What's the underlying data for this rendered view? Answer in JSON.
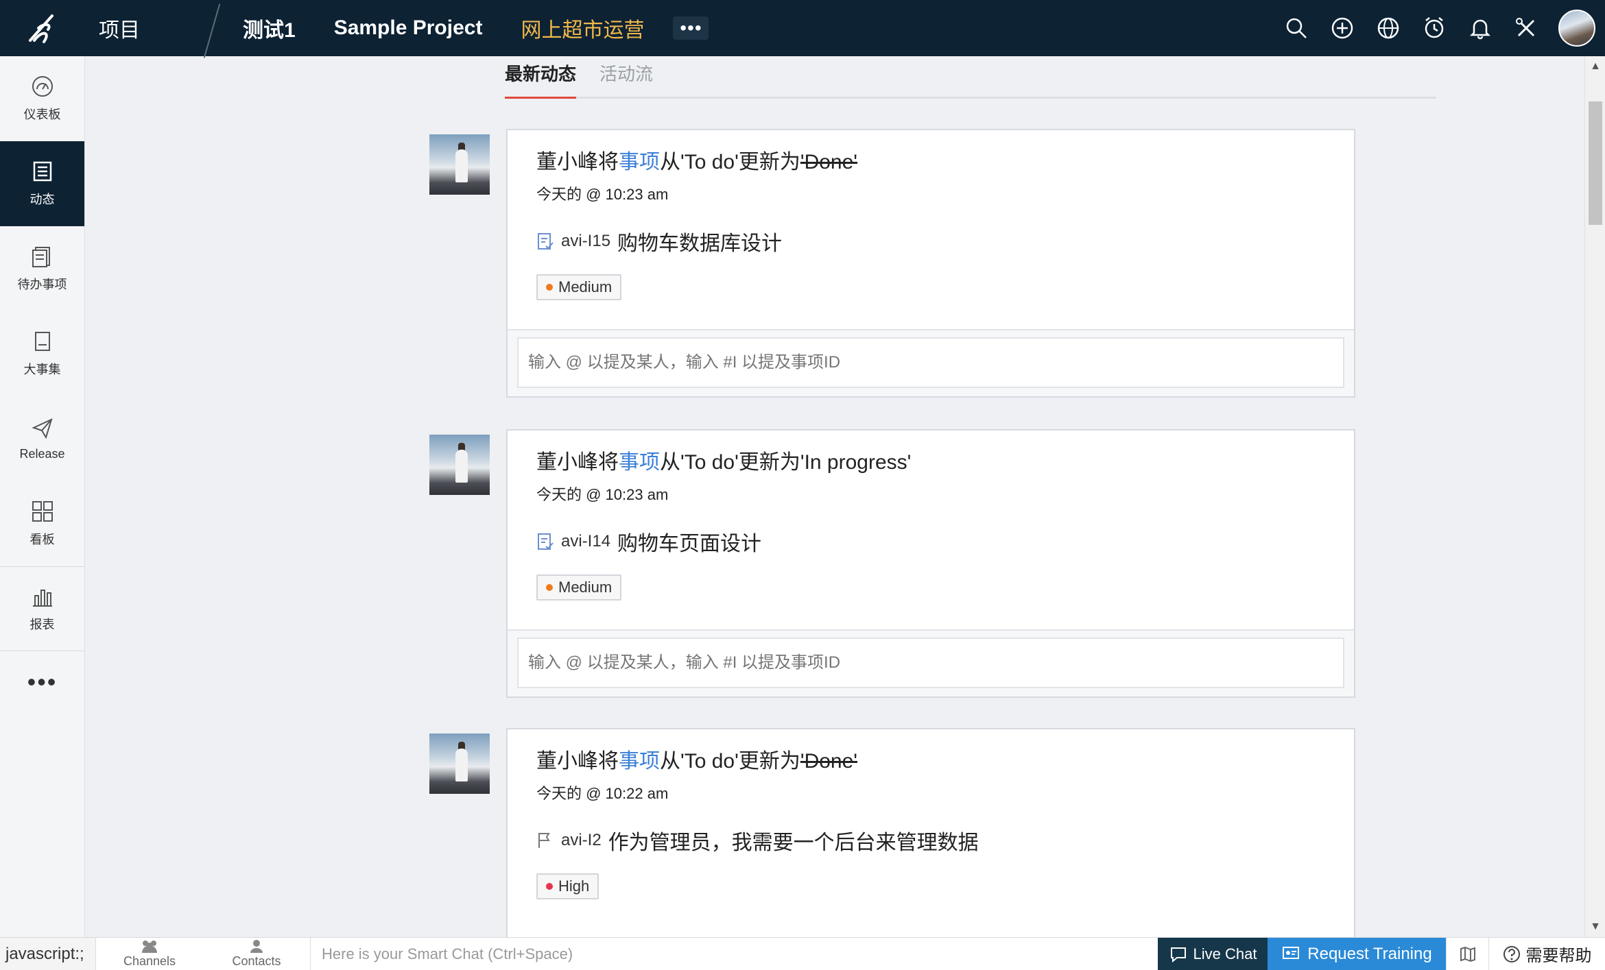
{
  "topbar": {
    "nav": [
      "项目",
      "测试1",
      "Sample Project",
      "网上超市运营"
    ],
    "more": "•••",
    "colors": {
      "bg": "#0d2233",
      "active": "#f2b84b"
    }
  },
  "sidebar": {
    "items": [
      {
        "label": "仪表板",
        "icon": "dashboard-icon"
      },
      {
        "label": "动态",
        "icon": "feed-icon"
      },
      {
        "label": "待办事项",
        "icon": "backlog-icon"
      },
      {
        "label": "大事集",
        "icon": "epic-icon"
      },
      {
        "label": "Release",
        "icon": "release-icon"
      },
      {
        "label": "看板",
        "icon": "board-icon"
      },
      {
        "label": "报表",
        "icon": "report-icon"
      }
    ],
    "more": "•••"
  },
  "tabs": [
    "最新动态",
    "活动流"
  ],
  "feed": [
    {
      "title_prefix": "董小峰将",
      "title_link": "事项",
      "title_mid": "从'To do'更新为",
      "title_status": "'Done'",
      "time": "今天的 @ 10:23 am",
      "item_id": "avi-I15",
      "item_title": "购物车数据库设计",
      "priority": "Medium",
      "priority_color": "#f07a1e",
      "comment_placeholder": "输入 @ 以提及某人，输入 #I 以提及事项ID"
    },
    {
      "title_prefix": "董小峰将",
      "title_link": "事项",
      "title_mid": "从'To do'更新为",
      "title_status": "'In progress'",
      "time": "今天的 @ 10:23 am",
      "item_id": "avi-I14",
      "item_title": "购物车页面设计",
      "priority": "Medium",
      "priority_color": "#f07a1e",
      "comment_placeholder": "输入 @ 以提及某人，输入 #I 以提及事项ID"
    },
    {
      "title_prefix": "董小峰将",
      "title_link": "事项",
      "title_mid": "从'To do'更新为",
      "title_status": "'Done'",
      "time": "今天的 @ 10:22 am",
      "item_id": "avi-I2",
      "item_title": "作为管理员，我需要一个后台来管理数据",
      "priority": "High",
      "priority_color": "#e8334d"
    }
  ],
  "bottombar": {
    "status_url": "javascript:;",
    "channels": "Channels",
    "contacts": "Contacts",
    "smart_chat_placeholder": "Here is your Smart Chat (Ctrl+Space)",
    "live_chat": "Live Chat",
    "request_training": "Request Training",
    "help": "需要帮助"
  }
}
